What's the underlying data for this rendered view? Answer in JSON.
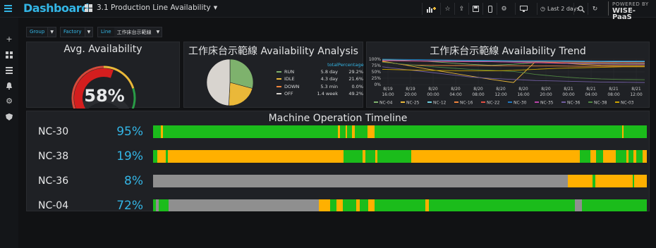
{
  "app": {
    "logo": "Dashboard",
    "dashboard_title": "3.1 Production Line Availability",
    "powered_by": "POWERED BY",
    "brand": "WISE-PaaS"
  },
  "toolbar": {
    "time_range": "Last 2 days"
  },
  "variables": [
    {
      "label": "Group",
      "value": ""
    },
    {
      "label": "Factory",
      "value": ""
    },
    {
      "label": "Line",
      "value": "工作床台示範線"
    }
  ],
  "gauge": {
    "title": "Avg. Availability",
    "value": 58,
    "display": "58%"
  },
  "pie": {
    "title": "工作床台示範線 Availability Analysis",
    "header_total": "total",
    "header_pct": "Percentage",
    "rows": [
      {
        "name": "RUN",
        "total": "5.8 day",
        "pct": "29.2%",
        "value": 29.2,
        "color": "#7eb26d"
      },
      {
        "name": "IDLE",
        "total": "4.3 day",
        "pct": "21.6%",
        "value": 21.6,
        "color": "#eab839"
      },
      {
        "name": "DOWN",
        "total": "5.3 min",
        "pct": "0.0%",
        "value": 0.0,
        "color": "#ef843c"
      },
      {
        "name": "OFF",
        "total": "1.4 week",
        "pct": "49.2%",
        "value": 49.2,
        "color": "#d8d4cf"
      }
    ]
  },
  "chart_data": {
    "type": "line",
    "title": "工作床台示範線 Availability Trend",
    "y_ticks": [
      "100%",
      "75%",
      "50%",
      "25%",
      "0%"
    ],
    "ylim": [
      0,
      100
    ],
    "x_ticks": [
      {
        "d": "8/19",
        "t": "16:00"
      },
      {
        "d": "8/19",
        "t": "20:00"
      },
      {
        "d": "8/20",
        "t": "00:00"
      },
      {
        "d": "8/20",
        "t": "04:00"
      },
      {
        "d": "8/20",
        "t": "08:00"
      },
      {
        "d": "8/20",
        "t": "12:00"
      },
      {
        "d": "8/20",
        "t": "16:00"
      },
      {
        "d": "8/20",
        "t": "20:00"
      },
      {
        "d": "8/21",
        "t": "00:00"
      },
      {
        "d": "8/21",
        "t": "04:00"
      },
      {
        "d": "8/21",
        "t": "08:00"
      },
      {
        "d": "8/21",
        "t": "12:00"
      }
    ],
    "series": [
      {
        "name": "NC-04",
        "color": "#7eb26d",
        "values": [
          98,
          96,
          92,
          86,
          80,
          76,
          80,
          86,
          85,
          84,
          84,
          83,
          83
        ]
      },
      {
        "name": "NC-25",
        "color": "#eab839",
        "values": [
          92,
          78,
          62,
          48,
          34,
          20,
          8,
          90,
          86,
          80,
          76,
          75,
          75
        ]
      },
      {
        "name": "NC-12",
        "color": "#6ed0e0",
        "values": [
          96,
          95,
          94,
          94,
          93,
          93,
          92,
          92,
          92,
          91,
          91,
          90,
          90
        ]
      },
      {
        "name": "NC-16",
        "color": "#ef843c",
        "values": [
          90,
          78,
          76,
          75,
          75,
          74,
          74,
          73,
          73,
          72,
          72,
          71,
          71
        ]
      },
      {
        "name": "NC-22",
        "color": "#e24d42",
        "values": [
          94,
          93,
          92,
          91,
          90,
          90,
          89,
          89,
          88,
          88,
          87,
          87,
          86
        ]
      },
      {
        "name": "NC-30",
        "color": "#1f78c1",
        "values": [
          100,
          99,
          98,
          97,
          96,
          95,
          94,
          94,
          94,
          94,
          93,
          93,
          93
        ]
      },
      {
        "name": "NC-35",
        "color": "#ba43a9",
        "values": [
          95,
          94,
          93,
          92,
          91,
          90,
          88,
          86,
          84,
          82,
          81,
          80,
          80
        ]
      },
      {
        "name": "NC-36",
        "color": "#705da0",
        "values": [
          70,
          60,
          50,
          40,
          30,
          24,
          20,
          16,
          14,
          12,
          10,
          9,
          8
        ]
      },
      {
        "name": "NC-38",
        "color": "#508642",
        "values": [
          88,
          80,
          72,
          66,
          60,
          56,
          52,
          40,
          32,
          26,
          22,
          20,
          19
        ]
      },
      {
        "name": "NC-03",
        "color": "#cca300",
        "values": [
          60,
          58,
          56,
          55,
          54,
          54,
          56,
          60,
          64,
          66,
          68,
          70,
          70
        ]
      }
    ]
  },
  "timeline": {
    "title": "Machine Operation Timeline",
    "colors": {
      "run": "#1bbc1b",
      "idle": "#ffb000",
      "off": "#8f8f8f",
      "down": "#e8791c"
    },
    "machines": [
      {
        "name": "NC-30",
        "pct": "95%",
        "segments": [
          [
            "run",
            1.6
          ],
          [
            "idle",
            0.4
          ],
          [
            "run",
            35.4
          ],
          [
            "idle",
            0.4
          ],
          [
            "run",
            1.2
          ],
          [
            "idle",
            0.3
          ],
          [
            "run",
            1.0
          ],
          [
            "idle",
            0.6
          ],
          [
            "run",
            2.5
          ],
          [
            "idle",
            1.4
          ],
          [
            "run",
            50.2
          ],
          [
            "idle",
            0.3
          ],
          [
            "run",
            4.7
          ]
        ]
      },
      {
        "name": "NC-38",
        "pct": "19%",
        "segments": [
          [
            "run",
            0.8
          ],
          [
            "idle",
            1.6
          ],
          [
            "run",
            0.4
          ],
          [
            "idle",
            32.6
          ],
          [
            "run",
            3.6
          ],
          [
            "idle",
            0.5
          ],
          [
            "run",
            1.8
          ],
          [
            "idle",
            0.4
          ],
          [
            "run",
            6.3
          ],
          [
            "idle",
            31.3
          ],
          [
            "run",
            2.0
          ],
          [
            "idle",
            1.1
          ],
          [
            "run",
            1.3
          ],
          [
            "idle",
            2.4
          ],
          [
            "run",
            1.9
          ],
          [
            "idle",
            0.4
          ],
          [
            "run",
            0.9
          ],
          [
            "idle",
            0.6
          ],
          [
            "run",
            1.1
          ],
          [
            "idle",
            0.8
          ]
        ]
      },
      {
        "name": "NC-36",
        "pct": "8%",
        "segments": [
          [
            "off",
            84.0
          ],
          [
            "idle",
            5.0
          ],
          [
            "run",
            0.5
          ],
          [
            "idle",
            7.6
          ],
          [
            "run",
            0.3
          ],
          [
            "idle",
            2.6
          ]
        ]
      },
      {
        "name": "NC-04",
        "pct": "72%",
        "segments": [
          [
            "run",
            0.5
          ],
          [
            "off",
            0.6
          ],
          [
            "run",
            2.0
          ],
          [
            "off",
            30.5
          ],
          [
            "idle",
            2.2
          ],
          [
            "run",
            1.3
          ],
          [
            "idle",
            1.3
          ],
          [
            "run",
            2.7
          ],
          [
            "idle",
            0.7
          ],
          [
            "run",
            1.8
          ],
          [
            "idle",
            1.3
          ],
          [
            "run",
            10.2
          ],
          [
            "idle",
            0.8
          ],
          [
            "run",
            29.6
          ],
          [
            "off",
            1.4
          ],
          [
            "run",
            13.1
          ]
        ]
      }
    ]
  }
}
